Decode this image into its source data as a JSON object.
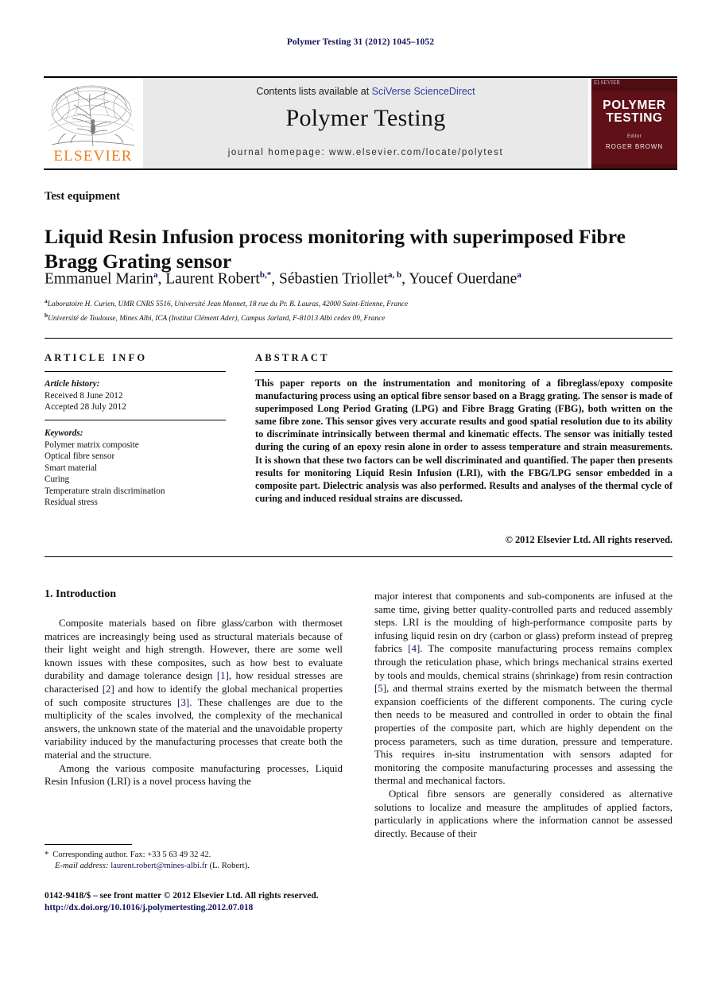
{
  "running_head": "Polymer Testing 31 (2012) 1045–1052",
  "masthead": {
    "contents_prefix": "Contents lists available at ",
    "sciencedirect": "SciVerse ScienceDirect",
    "journal_name": "Polymer Testing",
    "homepage": "journal homepage: www.elsevier.com/locate/polytest",
    "publisher_logo_text": "ELSEVIER",
    "cover": {
      "brand": "ELSEVIER",
      "title_line1": "POLYMER",
      "title_line2": "TESTING",
      "editor_label": "Editor",
      "editor_name": "ROGER BROWN"
    }
  },
  "article": {
    "section_type": "Test equipment",
    "title": "Liquid Resin Infusion process monitoring with superimposed Fibre Bragg Grating sensor",
    "authors": [
      {
        "name": "Emmanuel Marin",
        "marks": "a",
        "sep": ", "
      },
      {
        "name": "Laurent Robert",
        "marks": "b,*",
        "sep": ", "
      },
      {
        "name": "Sébastien Triollet",
        "marks": "a, b",
        "sep": ", "
      },
      {
        "name": "Youcef Ouerdane",
        "marks": "a",
        "sep": ""
      }
    ],
    "affiliations": [
      {
        "mark": "a",
        "text": "Laboratoire H. Curien, UMR CNRS 5516, Université Jean Monnet, 18 rue du Pr. B. Lauras, 42000 Saint-Etienne, France"
      },
      {
        "mark": "b",
        "text": "Université de Toulouse, Mines Albi, ICA (Institut Clément Ader), Campus Jarlard, F-81013 Albi cedex 09, France"
      }
    ]
  },
  "info": {
    "heading": "ARTICLE INFO",
    "history_label": "Article history:",
    "history": [
      "Received 8 June 2012",
      "Accepted 28 July 2012"
    ],
    "keywords_label": "Keywords:",
    "keywords": [
      "Polymer matrix composite",
      "Optical fibre sensor",
      "Smart material",
      "Curing",
      "Temperature strain discrimination",
      "Residual stress"
    ]
  },
  "abstract": {
    "heading": "ABSTRACT",
    "text": "This paper reports on the instrumentation and monitoring of a fibreglass/epoxy composite manufacturing process using an optical fibre sensor based on a Bragg grating. The sensor is made of superimposed Long Period Grating (LPG) and Fibre Bragg Grating (FBG), both written on the same fibre zone. This sensor gives very accurate results and good spatial resolution due to its ability to discriminate intrinsically between thermal and kinematic effects. The sensor was initially tested during the curing of an epoxy resin alone in order to assess temperature and strain measurements. It is shown that these two factors can be well discriminated and quantified. The paper then presents results for monitoring Liquid Resin Infusion (LRI), with the FBG/LPG sensor embedded in a composite part. Dielectric analysis was also performed. Results and analyses of the thermal cycle of curing and induced residual strains are discussed.",
    "copyright": "© 2012 Elsevier Ltd. All rights reserved."
  },
  "body": {
    "section_heading": "1. Introduction",
    "left_paragraphs": [
      {
        "parts": [
          {
            "t": "Composite materials based on fibre glass/carbon with thermoset matrices are increasingly being used as structural materials because of their light weight and high strength. However, there are some well known issues with these composites, such as how best to evaluate durability and damage tolerance design "
          },
          {
            "t": "[1]",
            "ref": true
          },
          {
            "t": ", how residual stresses are characterised "
          },
          {
            "t": "[2]",
            "ref": true
          },
          {
            "t": " and how to identify the global mechanical properties of such composite structures "
          },
          {
            "t": "[3]",
            "ref": true
          },
          {
            "t": ". These challenges are due to the multiplicity of the scales involved, the complexity of the mechanical answers, the unknown state of the material and the unavoidable property variability induced by the manufacturing processes that create both the material and the structure."
          }
        ]
      },
      {
        "parts": [
          {
            "t": "Among the various composite manufacturing processes, Liquid Resin Infusion (LRI) is a novel process having the"
          }
        ]
      }
    ],
    "right_paragraphs": [
      {
        "continued": true,
        "parts": [
          {
            "t": "major interest that components and sub-components are infused at the same time, giving better quality-controlled parts and reduced assembly steps. LRI is the moulding of high-performance composite parts by infusing liquid resin on dry (carbon or glass) preform instead of prepreg fabrics "
          },
          {
            "t": "[4]",
            "ref": true
          },
          {
            "t": ". The composite manufacturing process remains complex through the reticulation phase, which brings mechanical strains exerted by tools and moulds, chemical strains (shrinkage) from resin contraction "
          },
          {
            "t": "[5]",
            "ref": true
          },
          {
            "t": ", and thermal strains exerted by the mismatch between the thermal expansion coefficients of the different components. The curing cycle then needs to be measured and controlled in order to obtain the final properties of the composite part, which are highly dependent on the process parameters, such as time duration, pressure and temperature. This requires in-situ instrumentation with sensors adapted for monitoring the composite manufacturing processes and assessing the thermal and mechanical factors."
          }
        ]
      },
      {
        "parts": [
          {
            "t": "Optical fibre sensors are generally considered as alternative solutions to localize and measure the amplitudes of applied factors, particularly in applications where the information cannot be assessed directly. Because of their"
          }
        ]
      }
    ]
  },
  "footnote": {
    "star": "*",
    "corresponding": "Corresponding author. Fax: +33 5 63 49 32 42.",
    "email_label": "E-mail address:",
    "email": "laurent.robert@mines-albi.fr",
    "email_owner": "(L. Robert)."
  },
  "bottom": {
    "front_matter": "0142-9418/$ – see front matter © 2012 Elsevier Ltd. All rights reserved.",
    "doi": "http://dx.doi.org/10.1016/j.polymertesting.2012.07.018"
  },
  "colors": {
    "link_blue": "#131559",
    "elsevier_orange": "#f07f1a",
    "cover_maroon": "#601118",
    "masthead_grey": "#e9e9e9"
  }
}
